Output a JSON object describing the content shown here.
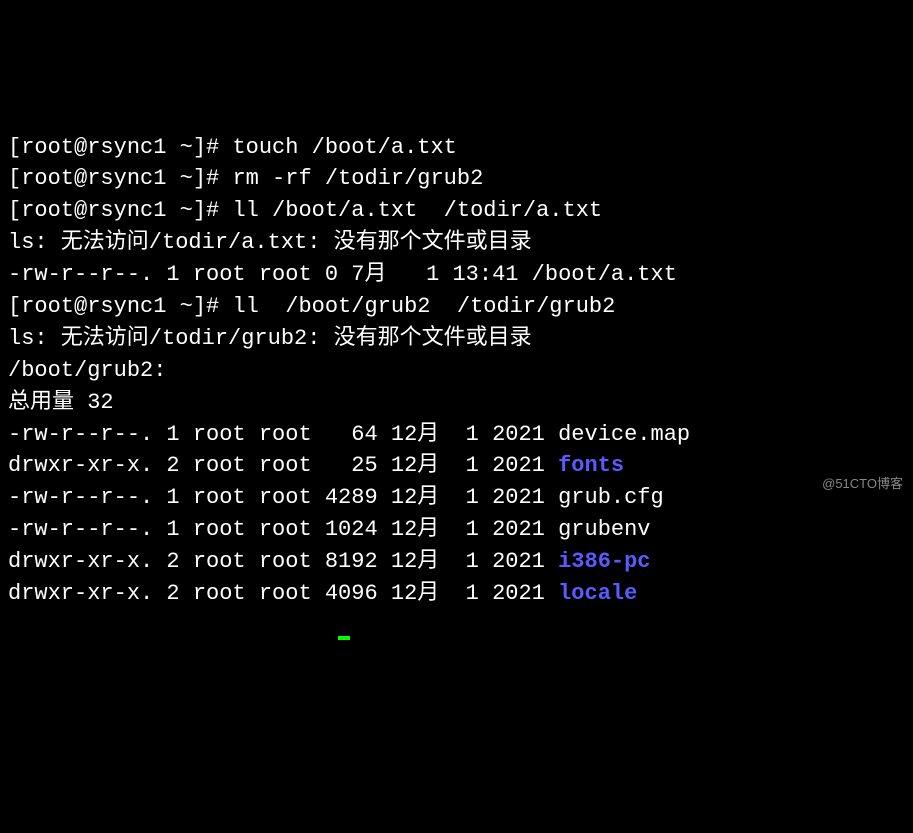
{
  "prompt": "[root@rsync1 ~]#",
  "commands": {
    "c1": "touch /boot/a.txt",
    "c2": "rm -rf /todir/grub2",
    "c3": "ll /boot/a.txt  /todir/a.txt",
    "c4": "ll  /boot/grub2  /todir/grub2"
  },
  "errors": {
    "e1": "ls: 无法访问/todir/a.txt: 没有那个文件或目录",
    "e2": "ls: 无法访问/todir/grub2: 没有那个文件或目录"
  },
  "file_line": "-rw-r--r--. 1 root root 0 7月   1 13:41 /boot/a.txt",
  "dir_header": "/boot/grub2:",
  "total_line": "总用量 32",
  "listing": [
    {
      "perms": "-rw-r--r--.",
      "links": "1",
      "owner": "root",
      "group": "root",
      "size": "  64",
      "month": "12月",
      "day": " 1",
      "year": "2021",
      "name": "device.map",
      "is_dir": false
    },
    {
      "perms": "drwxr-xr-x.",
      "links": "2",
      "owner": "root",
      "group": "root",
      "size": "  25",
      "month": "12月",
      "day": " 1",
      "year": "2021",
      "name": "fonts",
      "is_dir": true
    },
    {
      "perms": "-rw-r--r--.",
      "links": "1",
      "owner": "root",
      "group": "root",
      "size": "4289",
      "month": "12月",
      "day": " 1",
      "year": "2021",
      "name": "grub.cfg",
      "is_dir": false
    },
    {
      "perms": "-rw-r--r--.",
      "links": "1",
      "owner": "root",
      "group": "root",
      "size": "1024",
      "month": "12月",
      "day": " 1",
      "year": "2021",
      "name": "grubenv",
      "is_dir": false
    },
    {
      "perms": "drwxr-xr-x.",
      "links": "2",
      "owner": "root",
      "group": "root",
      "size": "8192",
      "month": "12月",
      "day": " 1",
      "year": "2021",
      "name": "i386-pc",
      "is_dir": true
    },
    {
      "perms": "drwxr-xr-x.",
      "links": "2",
      "owner": "root",
      "group": "root",
      "size": "4096",
      "month": "12月",
      "day": " 1",
      "year": "2021",
      "name": "locale",
      "is_dir": true
    }
  ],
  "watermark": "@51CTO博客"
}
